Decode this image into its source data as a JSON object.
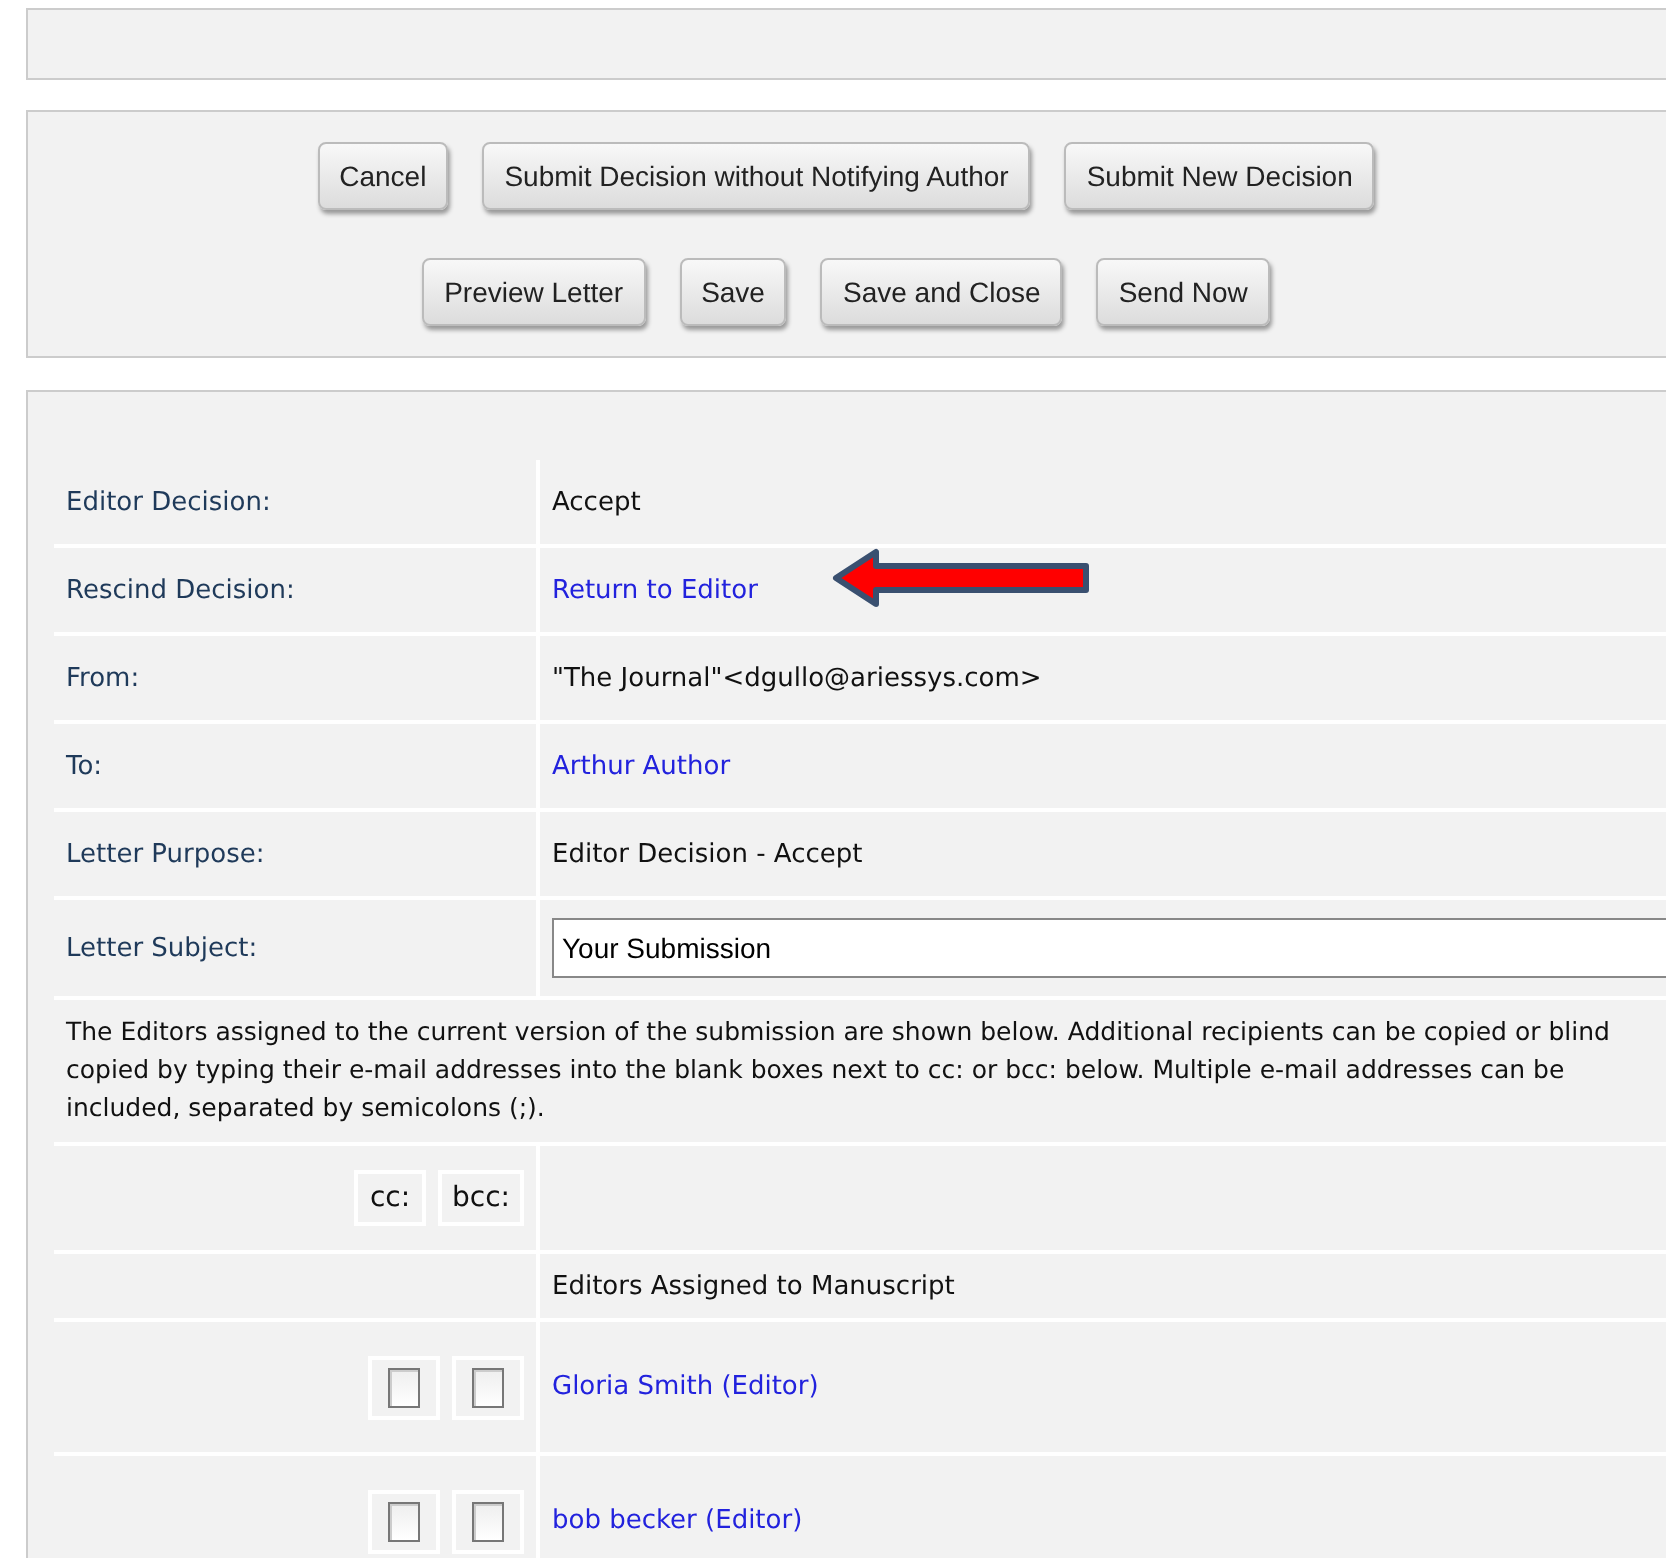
{
  "action_buttons": [
    [
      "Cancel",
      "Submit Decision without Notifying Author",
      "Submit New Decision"
    ],
    [
      "Preview Letter",
      "Save",
      "Save and Close",
      "Send Now"
    ]
  ],
  "fields": [
    {
      "label": "Editor Decision:",
      "value": "Accept",
      "kind": "text"
    },
    {
      "label": "Rescind Decision:",
      "value": "Return to Editor",
      "kind": "link",
      "pointer": true
    },
    {
      "label": "From:",
      "value": "\"The Journal\"<dgullo@ariessys.com>",
      "kind": "text"
    },
    {
      "label": "To:",
      "value": "Arthur Author",
      "kind": "link"
    },
    {
      "label": "Letter Purpose:",
      "value": "Editor Decision - Accept",
      "kind": "text"
    },
    {
      "label": "Letter Subject:",
      "value": "Your Submission",
      "kind": "input"
    }
  ],
  "instructions": "The Editors assigned to the current version of the submission are shown below. Additional recipients can be copied or blind copied by typing their e-mail addresses into the blank boxes next to cc: or bcc: below. Multiple e-mail addresses can be included, separated by semicolons (;).",
  "copy_headers": [
    "cc:",
    "bcc:"
  ],
  "editors_heading": "Editors Assigned to Manuscript",
  "editors": [
    {
      "name": "Gloria Smith (Editor)",
      "cc": false,
      "bcc": false
    },
    {
      "name": "bob becker (Editor)",
      "cc": false,
      "bcc": false
    }
  ]
}
